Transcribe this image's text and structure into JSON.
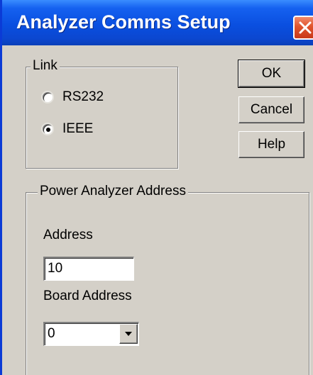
{
  "window": {
    "title": "Analyzer Comms Setup"
  },
  "link_group": {
    "label": "Link",
    "options": [
      {
        "label": "RS232",
        "selected": false
      },
      {
        "label": "IEEE",
        "selected": true
      }
    ]
  },
  "buttons": {
    "ok": "OK",
    "cancel": "Cancel",
    "help": "Help"
  },
  "address_group": {
    "label": "Power Analyzer Address",
    "address_label": "Address",
    "address_value": "10",
    "board_address_label": "Board Address",
    "board_address_value": "0"
  },
  "colors": {
    "titlebar": "#0a4fe0",
    "dialog_face": "#d4d0c8",
    "close_button": "#e0542c"
  },
  "icons": {
    "close": "close-icon",
    "dropdown": "chevron-down-icon"
  }
}
